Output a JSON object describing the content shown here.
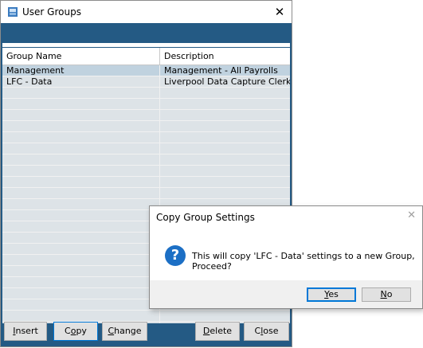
{
  "window": {
    "title": "User Groups",
    "close_glyph": "✕",
    "accent_color": "#245a84"
  },
  "grid": {
    "columns": [
      "Group Name",
      "Description"
    ],
    "rows": [
      {
        "name": "Management",
        "description": "Management - All Payrolls"
      },
      {
        "name": "LFC - Data",
        "description": "Liverpool Data Capture Clerks"
      }
    ],
    "empty_row_count": 22
  },
  "buttons": {
    "insert": {
      "pre": "",
      "key": "I",
      "post": "nsert"
    },
    "copy": {
      "pre": "C",
      "key": "o",
      "post": "py"
    },
    "change": {
      "pre": "",
      "key": "C",
      "post": "hange"
    },
    "delete": {
      "pre": "",
      "key": "D",
      "post": "elete"
    },
    "close": {
      "pre": "C",
      "key": "l",
      "post": "ose"
    }
  },
  "dialog": {
    "title": "Copy Group Settings",
    "close_glyph": "✕",
    "icon": "question-icon",
    "icon_glyph": "?",
    "message": "This will copy 'LFC - Data' settings to a new Group, Proceed?",
    "yes": {
      "key": "Y",
      "post": "es"
    },
    "no": {
      "key": "N",
      "post": "o"
    }
  }
}
